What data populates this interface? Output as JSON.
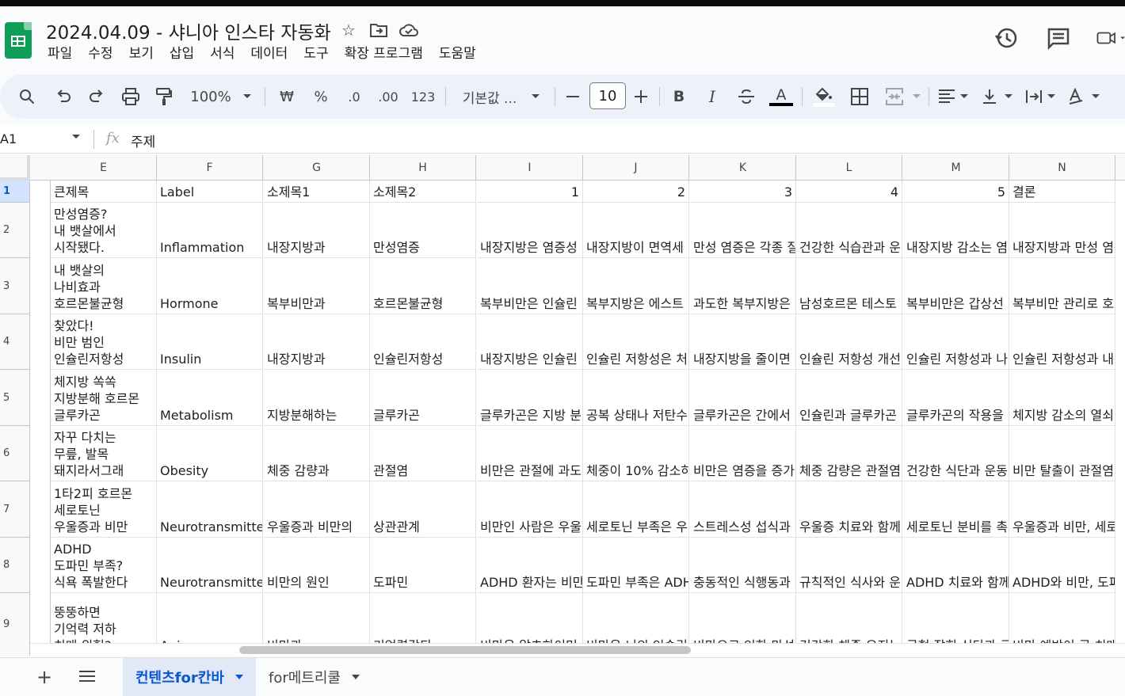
{
  "header": {
    "title": "2024.04.09 - 샤니아 인스타 자동화",
    "menu": [
      "파일",
      "수정",
      "보기",
      "삽입",
      "서식",
      "데이터",
      "도구",
      "확장 프로그램",
      "도움말"
    ]
  },
  "toolbar": {
    "zoom": "100%",
    "currency": "₩",
    "percent": "%",
    "dec_decrease": ".0",
    "dec_increase": ".00",
    "number_format": "123",
    "font": "기본값 ...",
    "font_size": "10",
    "bold": "B",
    "italic": "I",
    "text_color": "A"
  },
  "formula_bar": {
    "name_box": "A1",
    "fx": "fx",
    "value": "주제"
  },
  "columns": [
    "E",
    "F",
    "G",
    "H",
    "I",
    "J",
    "K",
    "L",
    "M",
    "N"
  ],
  "row_numbers": [
    "1",
    "2",
    "3",
    "4",
    "5",
    "6",
    "7",
    "8",
    "9"
  ],
  "rows": [
    [
      "큰제목",
      "Label",
      "소제목1",
      "소제목2",
      "1",
      "2",
      "3",
      "4",
      "5",
      "결론"
    ],
    [
      "만성염증?\n내 뱃살에서\n시작됐다.",
      "Inflammation",
      "내장지방과",
      "만성염증",
      "내장지방은 염증성",
      "내장지방이 면역세",
      "만성 염증은 각종 질",
      "건강한 식습관과 운",
      "내장지방 감소는 염",
      "내장지방과 만성 염증"
    ],
    [
      "내 뱃살의\n나비효과\n호르몬불균형",
      "Hormone",
      "복부비만과",
      "호르몬불균형",
      "복부비만은 인슐린",
      "복부지방은 에스트",
      "과도한 복부지방은",
      "남성호르몬 테스토",
      "복부비만은 갑상선",
      "복부비만 관리로 호르"
    ],
    [
      "찾았다!\n비만 범인\n인슐린저항성",
      "Insulin",
      "내장지방과",
      "인슐린저항성",
      "내장지방은 인슐린",
      "인슐린 저항성은 처",
      "내장지방을 줄이면",
      "인슐린 저항성 개선",
      "인슐린 저항성과 나",
      "인슐린 저항성과 내장"
    ],
    [
      "체지방 쏙쏙\n지방분해 호르몬\n글루카곤",
      "Metabolism",
      "지방분해하는",
      "글루카곤",
      "글루카곤은 지방 분",
      "공복 상태나 저탄수",
      "글루카곤은 간에서",
      "인슐린과 글루카곤",
      "글루카곤의 작용을",
      "체지방 감소의 열쇠,"
    ],
    [
      "자꾸 다치는\n무릎, 발목\n돼지라서그래",
      "Obesity",
      "체중 감량과",
      "관절염",
      "비만은 관절에 과도",
      "체중이 10% 감소하",
      "비만은 염증을 증가",
      "체중 감량은 관절염",
      "건강한 식단과 운동",
      "비만 탈출이 관절염 예"
    ],
    [
      "1타2피 호르몬\n세로토닌\n우울증과 비만",
      "Neurotransmitter",
      "우울증과 비만의",
      "상관관계",
      "비만인 사람은 우울",
      "세로토닌 부족은 우",
      "스트레스성 섭식과",
      "우울증 치료와 함께",
      "세로토닌 분비를 촉",
      "우울증과 비만, 세로토"
    ],
    [
      "ADHD\n도파민 부족?\n식욕 폭발한다",
      "Neurotransmitter",
      "비만의 원인",
      "도파민",
      "ADHD 환자는 비만",
      "도파민 부족은 ADH",
      "충동적인 식행동과",
      "규칙적인 식사와 운",
      "ADHD 치료와 함께",
      "ADHD와 비만, 도파민"
    ],
    [
      "뚱뚱하면\n기억력 저하\n치매 위험?",
      "Aging",
      "비만과",
      "기억력감퇴",
      "비만은 알츠하이머",
      "비만은 뇌의 인슐린",
      "비만으로 인한 만성",
      "건강한 체중 유지는",
      "균형 잡힌 식단과 규",
      "비만 예방이 곧 치매"
    ]
  ],
  "tabs": {
    "active": "컨텐츠for칸바",
    "other": "for메트리쿨"
  }
}
